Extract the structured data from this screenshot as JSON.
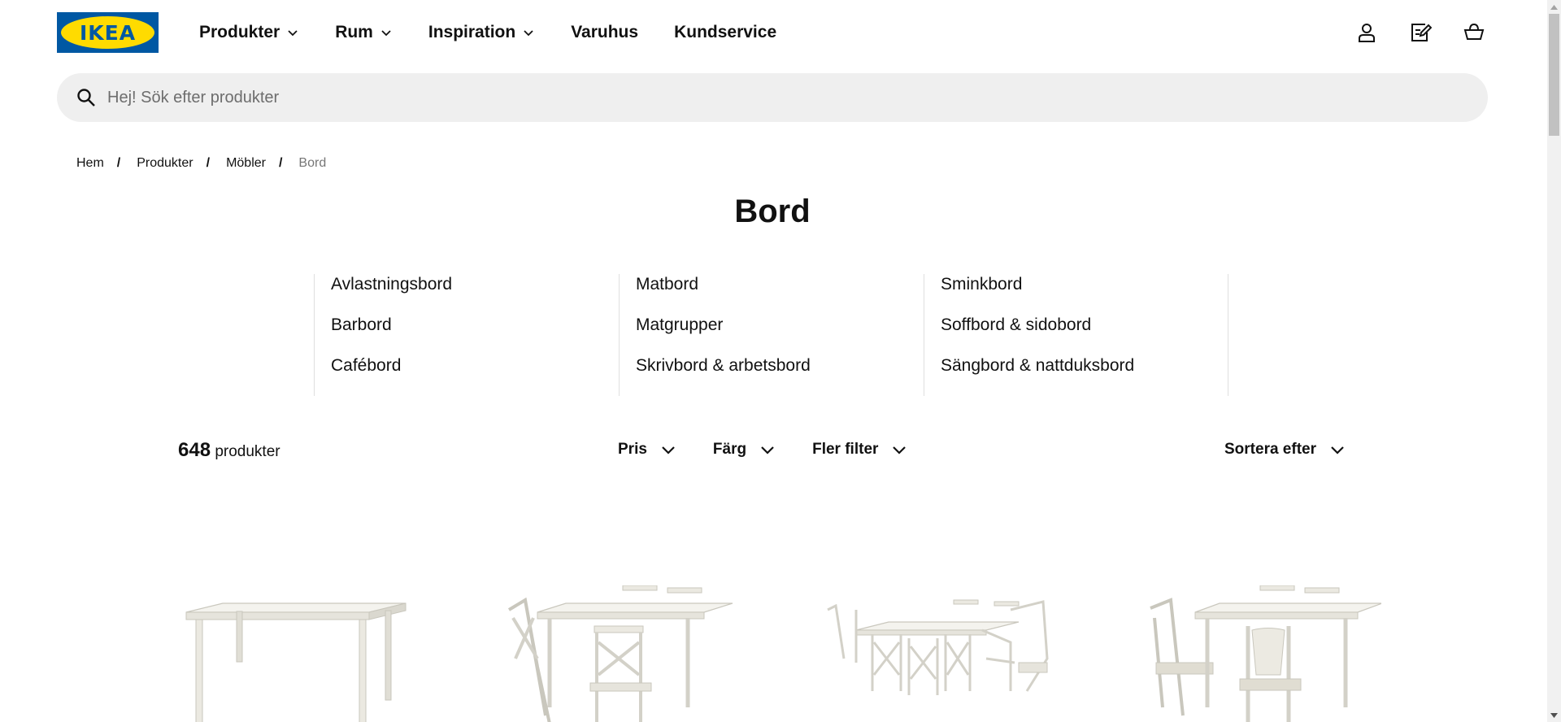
{
  "logo": {
    "text": "IKEA",
    "brand_blue": "#0058a3",
    "brand_yellow": "#ffdb00"
  },
  "nav": {
    "items": [
      {
        "label": "Produkter",
        "has_dropdown": true
      },
      {
        "label": "Rum",
        "has_dropdown": true
      },
      {
        "label": "Inspiration",
        "has_dropdown": true
      },
      {
        "label": "Varuhus",
        "has_dropdown": false
      },
      {
        "label": "Kundservice",
        "has_dropdown": false
      }
    ]
  },
  "header_icons": [
    "user-icon",
    "shopping-list-icon",
    "cart-icon"
  ],
  "search": {
    "placeholder": "Hej! Sök efter produkter",
    "value": ""
  },
  "breadcrumb": {
    "items": [
      "Hem",
      "Produkter",
      "Möbler",
      "Bord"
    ]
  },
  "page": {
    "title": "Bord"
  },
  "subcategories": {
    "columns": [
      [
        "Avlastningsbord",
        "Barbord",
        "Cafébord"
      ],
      [
        "Matbord",
        "Matgrupper",
        "Skrivbord & arbetsbord"
      ],
      [
        "Sminkbord",
        "Soffbord & sidobord",
        "Sängbord & nattduksbord"
      ]
    ]
  },
  "results": {
    "count": "648",
    "count_label": "produkter"
  },
  "filters": {
    "items": [
      "Pris",
      "Färg",
      "Fler filter"
    ],
    "sort_label": "Sortera efter"
  },
  "products": [
    {
      "image": "white-dining-table"
    },
    {
      "image": "white-table-with-chairs"
    },
    {
      "image": "white-table-with-six-chairs"
    },
    {
      "image": "white-table-with-armchairs"
    }
  ]
}
